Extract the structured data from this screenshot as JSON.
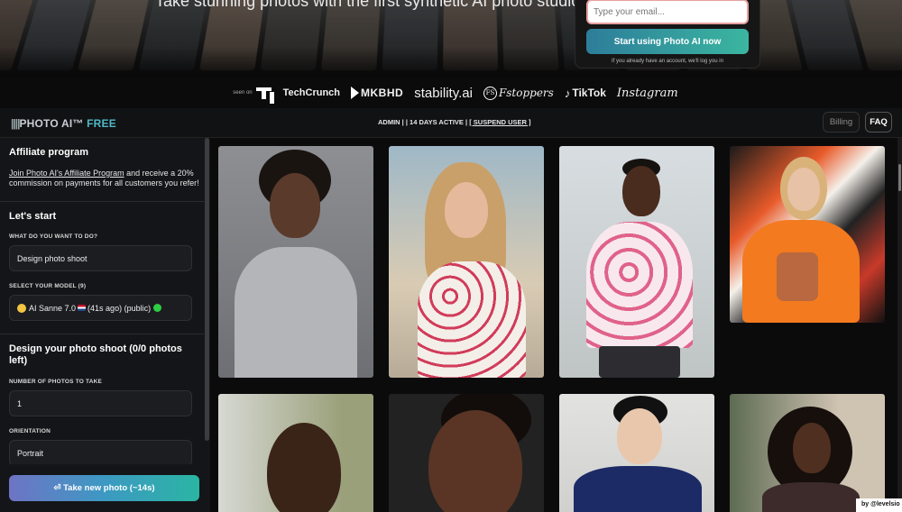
{
  "hero": {
    "tagline": "Take stunning photos with the first synthetic AI photo studio",
    "email_placeholder": "Type your email...",
    "start_button": "Start using Photo AI now",
    "login_note": "If you already have an account, we'll log you in"
  },
  "press": {
    "seen_on": "seen on",
    "logos": [
      "TechCrunch",
      "MKBHD",
      "stability.ai",
      "Fstoppers",
      "TikTok",
      "Instagram"
    ],
    "fstoppers_mark": "FS"
  },
  "header": {
    "brand_bars": "||||",
    "brand": "PHOTO AI™",
    "brand_tier": "FREE",
    "admin_status": "ADMIN | | 14 DAYS ACTIVE | ",
    "suspend_link": "[ SUSPEND USER ]",
    "billing": "Billing",
    "faq": "FAQ"
  },
  "sidebar": {
    "affiliate": {
      "title": "Affiliate program",
      "link": "Join Photo AI's Affiliate Program",
      "text": " and receive a 20% commission on payments for all customers you refer!"
    },
    "start": {
      "title": "Let's start",
      "what_label": "WHAT DO YOU WANT TO DO?",
      "what_value": "Design photo shoot",
      "model_label": "SELECT YOUR MODEL (9)",
      "model_value": "AI Sanne 7.0",
      "model_meta": "(41s ago) (public)"
    },
    "design": {
      "title": "Design your photo shoot (0/0 photos left)",
      "count_label": "NUMBER OF PHOTOS TO TAKE",
      "count_value": "1",
      "orientation_label": "ORIENTATION",
      "orientation_value": "Portrait"
    },
    "take_button": "⏎ Take new photo (~14s)"
  },
  "gallery": {
    "photos": [
      {
        "name": "woman-grey-top"
      },
      {
        "name": "woman-floral-dress"
      },
      {
        "name": "man-floral-shirt"
      },
      {
        "name": "woman-orange-tee-graffiti"
      },
      {
        "name": "man-portrait"
      },
      {
        "name": "woman-portrait"
      },
      {
        "name": "man-blue-sweater"
      },
      {
        "name": "woman-curly-hair"
      }
    ]
  },
  "credit": "by @levelsio",
  "colors": {
    "accent_teal": "#3bb6a0",
    "accent_blue": "#2d7d9a",
    "brand_free": "#4fb8c5",
    "status_green": "#2ecc40"
  }
}
